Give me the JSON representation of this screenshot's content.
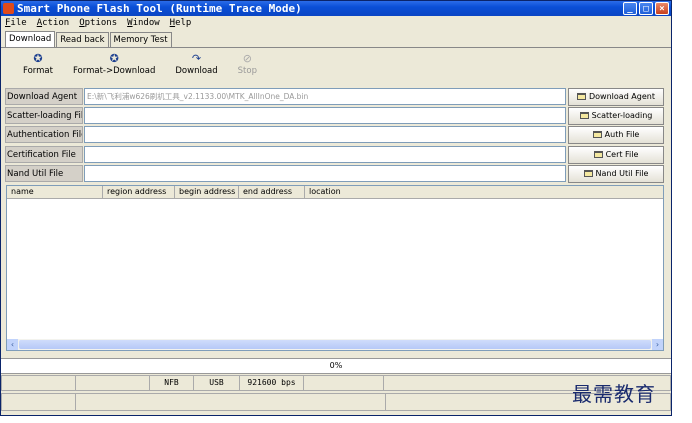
{
  "window": {
    "title": "Smart Phone Flash Tool (Runtime Trace Mode)"
  },
  "menu": [
    "File",
    "Action",
    "Options",
    "Window",
    "Help"
  ],
  "tabs": [
    "Download",
    "Read back",
    "Memory Test"
  ],
  "toolbar": {
    "format": "Format",
    "format_download": "Format->Download",
    "download": "Download",
    "stop": "Stop"
  },
  "fields": {
    "download_agent": {
      "label": "Download Agent",
      "value": "E:\\新\\飞利浦w626刷机工具_v2.1133.00\\MTK_AllInOne_DA.bin"
    },
    "scatter": {
      "label": "Scatter-loading File",
      "value": ""
    },
    "auth": {
      "label": "Authentication File",
      "value": ""
    },
    "cert": {
      "label": "Certification File",
      "value": ""
    },
    "nand": {
      "label": "Nand Util File",
      "value": ""
    }
  },
  "buttons": {
    "download_agent": "Download Agent",
    "scatter": "Scatter-loading",
    "auth": "Auth File",
    "cert": "Cert File",
    "nand": "Nand Util File"
  },
  "table": {
    "columns": [
      "name",
      "region address",
      "begin address",
      "end address",
      "location"
    ]
  },
  "progress": {
    "text": "0%",
    "value": 0
  },
  "status": {
    "flash": "NFB",
    "port": "USB",
    "baud": "921600 bps"
  },
  "watermark": "最需教育",
  "icons": {
    "format": "format-icon",
    "format_download": "format-download-icon",
    "download": "download-icon",
    "stop": "stop-icon",
    "folder": "folder-icon"
  }
}
